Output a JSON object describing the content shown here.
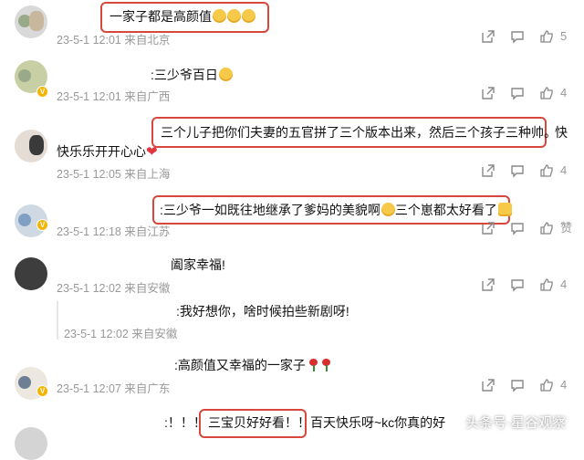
{
  "comments": [
    {
      "text": "一家子都是高颜值",
      "meta": "23-5-1 12:01 来自北京",
      "likes": "5"
    },
    {
      "text": ":三少爷百日",
      "meta": "23-5-1 12:01 来自广西",
      "likes": "4"
    },
    {
      "text": "三个儿子把你们夫妻的五官拼了三个版本出来，然后三个孩子三种帅。",
      "text_tail": "快",
      "text_line2": "快乐乐开开心心",
      "meta": "23-5-1 12:05 来自上海",
      "likes": "4"
    },
    {
      "text": ":三少爷一如既往地继承了爹妈的美貌啊",
      "text_b": "三个崽都太好看了",
      "meta": "23-5-1 12:18 来自江苏",
      "likes": "赞"
    },
    {
      "text": "阖家幸福!",
      "meta": "23-5-1 12:02 来自安徽",
      "likes": "4"
    },
    {
      "text": ":我好想你，啥时候拍些新剧呀!",
      "meta": "23-5-1 12:02 来自安徽"
    },
    {
      "text": ":高颜值又幸福的一家子",
      "meta": "23-5-1 12:07 来自广东",
      "likes": "4"
    },
    {
      "text_a": ":！！！",
      "text": "三宝贝好好看！！",
      "text_b": "百天快乐呀~kc你真的好",
      "watermark": "头条号·星谷观察"
    }
  ],
  "icons": {
    "share": "share-icon",
    "comment": "comment-icon",
    "like": "thumbs-up-icon"
  },
  "colors": {
    "highlight": "#d8473b",
    "meta": "#999999",
    "badge": "#f4b400"
  }
}
